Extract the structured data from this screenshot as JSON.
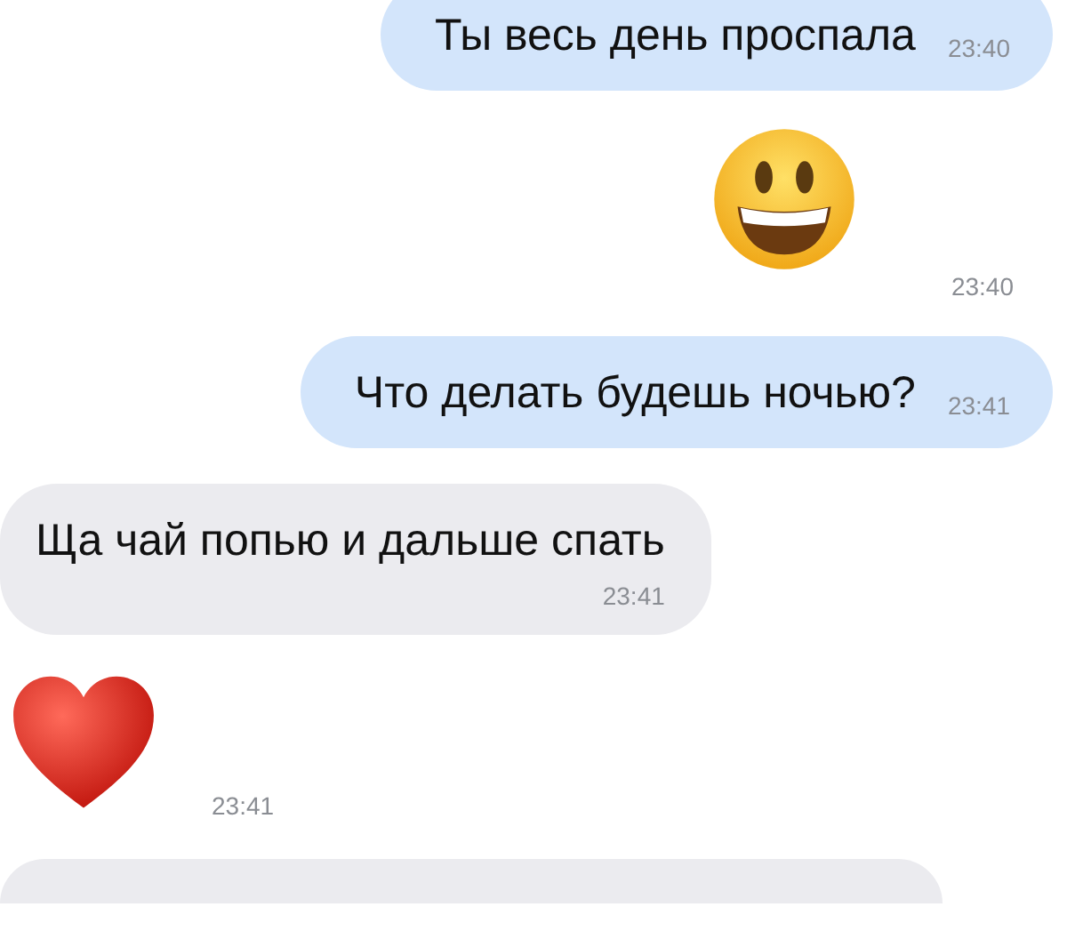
{
  "messages": [
    {
      "kind": "text",
      "outgoing": true,
      "text": "Ты весь день проспала",
      "time": "23:40"
    },
    {
      "kind": "smiley",
      "outgoing": true,
      "time": "23:40"
    },
    {
      "kind": "text",
      "outgoing": true,
      "text": "Что делать будешь ночью?",
      "time": "23:41"
    },
    {
      "kind": "text",
      "outgoing": false,
      "text": "Ща чай попью и дальше спать",
      "time": "23:41"
    },
    {
      "kind": "heart",
      "outgoing": false,
      "time": "23:41"
    },
    {
      "kind": "cut",
      "outgoing": false
    }
  ]
}
